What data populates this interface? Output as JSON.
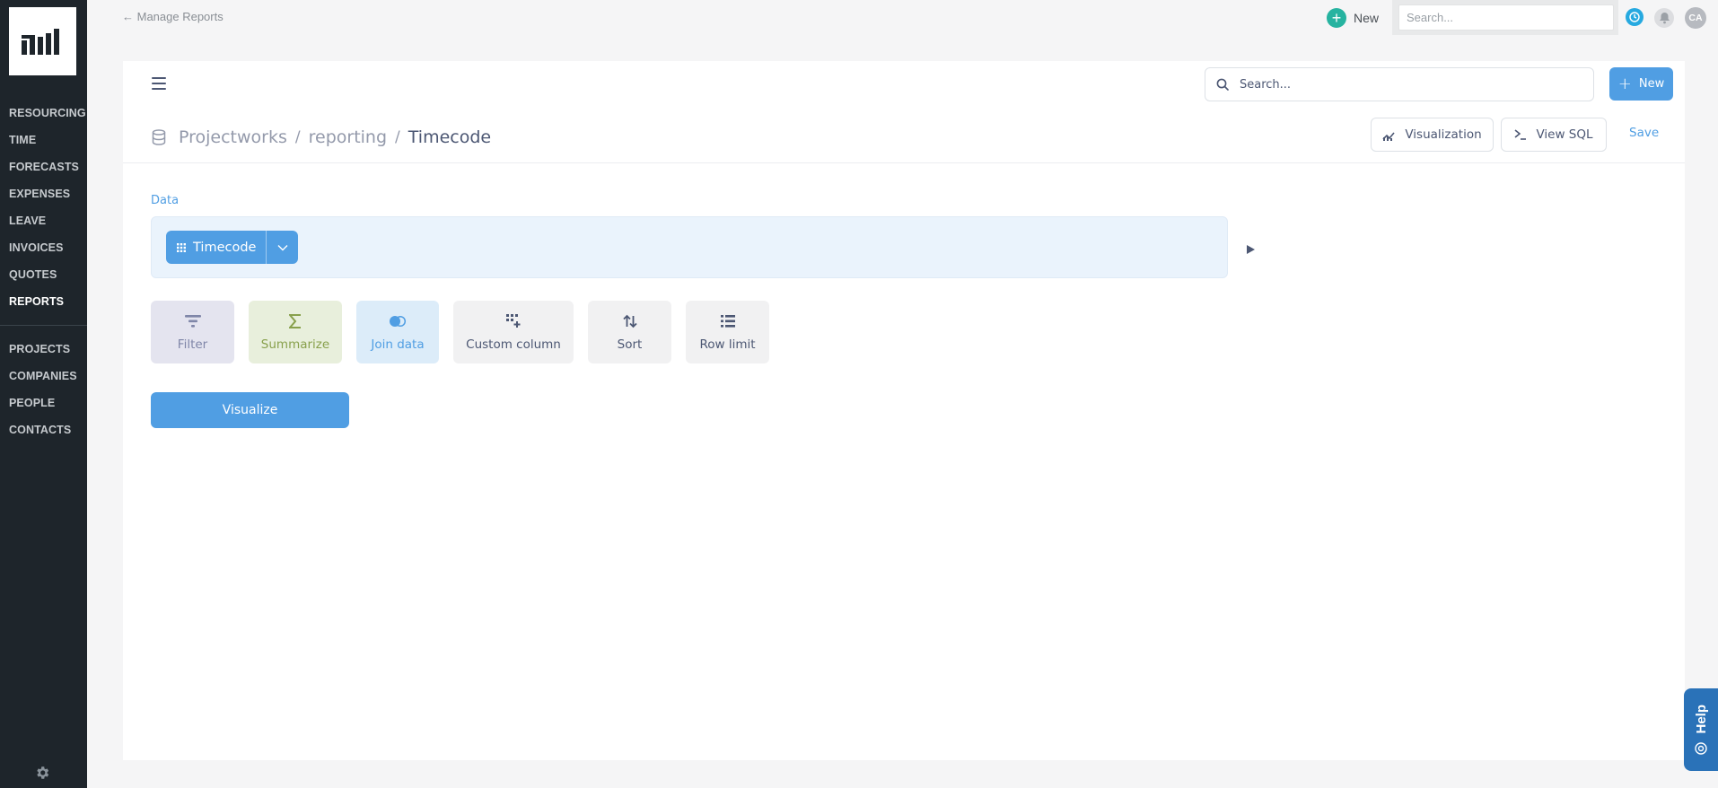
{
  "sidebar": {
    "nav_primary": [
      {
        "label": "RESOURCING",
        "active": false
      },
      {
        "label": "TIME",
        "active": false
      },
      {
        "label": "FORECASTS",
        "active": false
      },
      {
        "label": "EXPENSES",
        "active": false
      },
      {
        "label": "LEAVE",
        "active": false
      },
      {
        "label": "INVOICES",
        "active": false
      },
      {
        "label": "QUOTES",
        "active": false
      },
      {
        "label": "REPORTS",
        "active": true
      }
    ],
    "nav_secondary": [
      {
        "label": "PROJECTS"
      },
      {
        "label": "COMPANIES"
      },
      {
        "label": "PEOPLE"
      },
      {
        "label": "CONTACTS"
      }
    ]
  },
  "topbar": {
    "back_link": "← Manage Reports",
    "new_label": "New",
    "search_placeholder": "Search...",
    "avatar_initials": "CA"
  },
  "editor": {
    "search_placeholder": "Search...",
    "new_label": "New",
    "breadcrumb": {
      "database": "Projectworks",
      "schema": "reporting",
      "table": "Timecode"
    },
    "visualization_label": "Visualization",
    "view_sql_label": "View SQL",
    "save_label": "Save",
    "data_label": "Data",
    "source_table": "Timecode",
    "steps": {
      "filter": "Filter",
      "summarize": "Summarize",
      "join": "Join data",
      "custom": "Custom column",
      "sort": "Sort",
      "limit": "Row limit"
    },
    "visualize_label": "Visualize"
  },
  "help": {
    "label": "Help"
  },
  "colors": {
    "accent": "#509ee3",
    "sidebar_bg": "#1e252b",
    "teal": "#26b3a0",
    "help_tab": "#2a72b8"
  }
}
